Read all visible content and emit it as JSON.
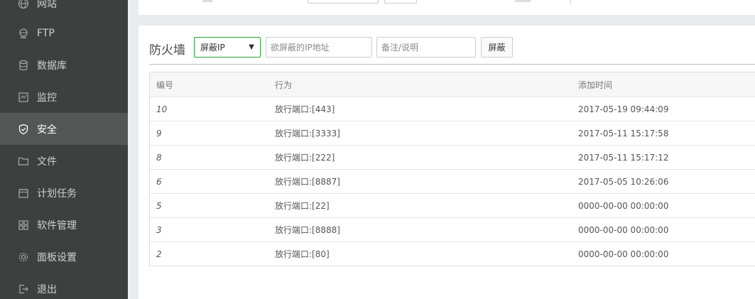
{
  "sidebar": {
    "items": [
      {
        "label": "网站",
        "icon": "globe-icon"
      },
      {
        "label": "FTP",
        "icon": "ftp-icon"
      },
      {
        "label": "数据库",
        "icon": "database-icon"
      },
      {
        "label": "监控",
        "icon": "monitor-icon"
      },
      {
        "label": "安全",
        "icon": "shield-icon",
        "active": true
      },
      {
        "label": "文件",
        "icon": "folder-icon"
      },
      {
        "label": "计划任务",
        "icon": "calendar-icon"
      },
      {
        "label": "软件管理",
        "icon": "grid-icon"
      },
      {
        "label": "面板设置",
        "icon": "gear-icon"
      },
      {
        "label": "退出",
        "icon": "logout-icon"
      }
    ]
  },
  "firewall": {
    "title": "防火墙",
    "select_value": "屏蔽IP",
    "ip_placeholder": "欲屏蔽的IP地址",
    "note_placeholder": "备注/说明",
    "block_button": "屏蔽"
  },
  "table": {
    "headers": {
      "id": "编号",
      "action": "行为",
      "time": "添加时间"
    },
    "rows": [
      {
        "id": "10",
        "action": "放行端口:[443]",
        "time": "2017-05-19 09:44:09"
      },
      {
        "id": "9",
        "action": "放行端口:[3333]",
        "time": "2017-05-11 15:17:58"
      },
      {
        "id": "8",
        "action": "放行端口:[222]",
        "time": "2017-05-11 15:17:12"
      },
      {
        "id": "6",
        "action": "放行端口:[8887]",
        "time": "2017-05-05 10:26:06"
      },
      {
        "id": "5",
        "action": "放行端口:[22]",
        "time": "0000-00-00 00:00:00"
      },
      {
        "id": "3",
        "action": "放行端口:[8888]",
        "time": "0000-00-00 00:00:00"
      },
      {
        "id": "2",
        "action": "放行端口:[80]",
        "time": "0000-00-00 00:00:00"
      }
    ]
  },
  "colors": {
    "sidebar_bg": "#3e3f3f",
    "active_bg": "#555656",
    "accent": "#20a53a"
  }
}
